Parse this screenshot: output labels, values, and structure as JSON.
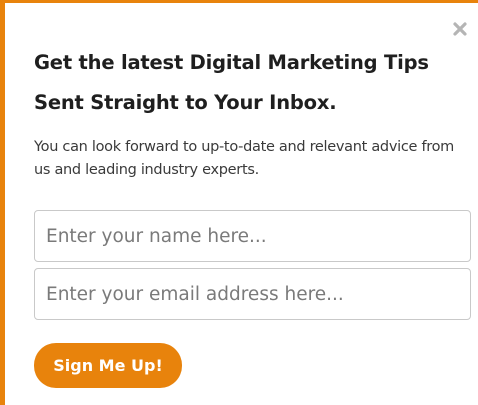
{
  "popup": {
    "close_icon": "close-icon",
    "headline_line1": "Get the latest Digital Marketing Tips",
    "headline_line2": "Sent Straight to Your Inbox.",
    "description": "You can look forward to up-to-date and relevant advice from us and leading industry experts.",
    "name_placeholder": "Enter your name here...",
    "name_value": "",
    "email_placeholder": "Enter your email address here...",
    "email_value": "",
    "submit_label": "Sign Me Up!"
  },
  "colors": {
    "accent": "#e8830c",
    "heading": "#1f1f1f",
    "body_text": "#3a3a3a",
    "field_border": "#c9c9c9",
    "close_icon": "#b5b5b5"
  }
}
